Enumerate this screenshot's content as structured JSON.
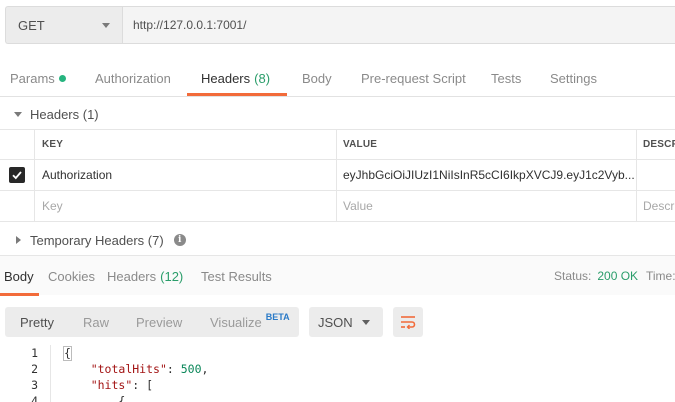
{
  "request": {
    "method": "GET",
    "url": "http://127.0.0.1:7001/"
  },
  "request_tabs": [
    {
      "label": "Params",
      "has_dot": true
    },
    {
      "label": "Authorization"
    },
    {
      "label": "Headers",
      "count": "(8)",
      "active": true
    },
    {
      "label": "Body"
    },
    {
      "label": "Pre-request Script"
    },
    {
      "label": "Tests"
    },
    {
      "label": "Settings"
    }
  ],
  "headers_section": {
    "title": "Headers (1)",
    "columns": {
      "key": "KEY",
      "value": "VALUE",
      "description": "DESCR"
    },
    "rows": [
      {
        "checked": true,
        "key": "Authorization",
        "value": "eyJhbGciOiJIUzI1NiIsInR5cCI6IkpXVCJ9.eyJ1c2Vyb..."
      }
    ],
    "placeholder": {
      "key": "Key",
      "value": "Value",
      "description": "Descr"
    },
    "temporary_title": "Temporary Headers (7)"
  },
  "response_tabs": [
    {
      "label": "Body",
      "active": true
    },
    {
      "label": "Cookies"
    },
    {
      "label": "Headers",
      "count": "(12)"
    },
    {
      "label": "Test Results"
    }
  ],
  "response_status": {
    "status_label": "Status:",
    "status_value": "200 OK",
    "time_label": "Time:"
  },
  "format_toolbar": {
    "modes": [
      "Pretty",
      "Raw",
      "Preview",
      "Visualize"
    ],
    "active_mode": "Pretty",
    "beta_badge": "BETA",
    "language": "JSON"
  },
  "code": {
    "line_numbers": [
      "1",
      "2",
      "3",
      "4"
    ],
    "line1": "{",
    "line2_key": "\"totalHits\"",
    "line2_sep": ": ",
    "line2_value": "500",
    "line2_end": ",",
    "line3_key": "\"hits\"",
    "line3_rest": ": [",
    "line4": "{"
  },
  "colors": {
    "accent": "#f26b3a",
    "success": "#2a9d6a",
    "dot": "#26b47f"
  }
}
